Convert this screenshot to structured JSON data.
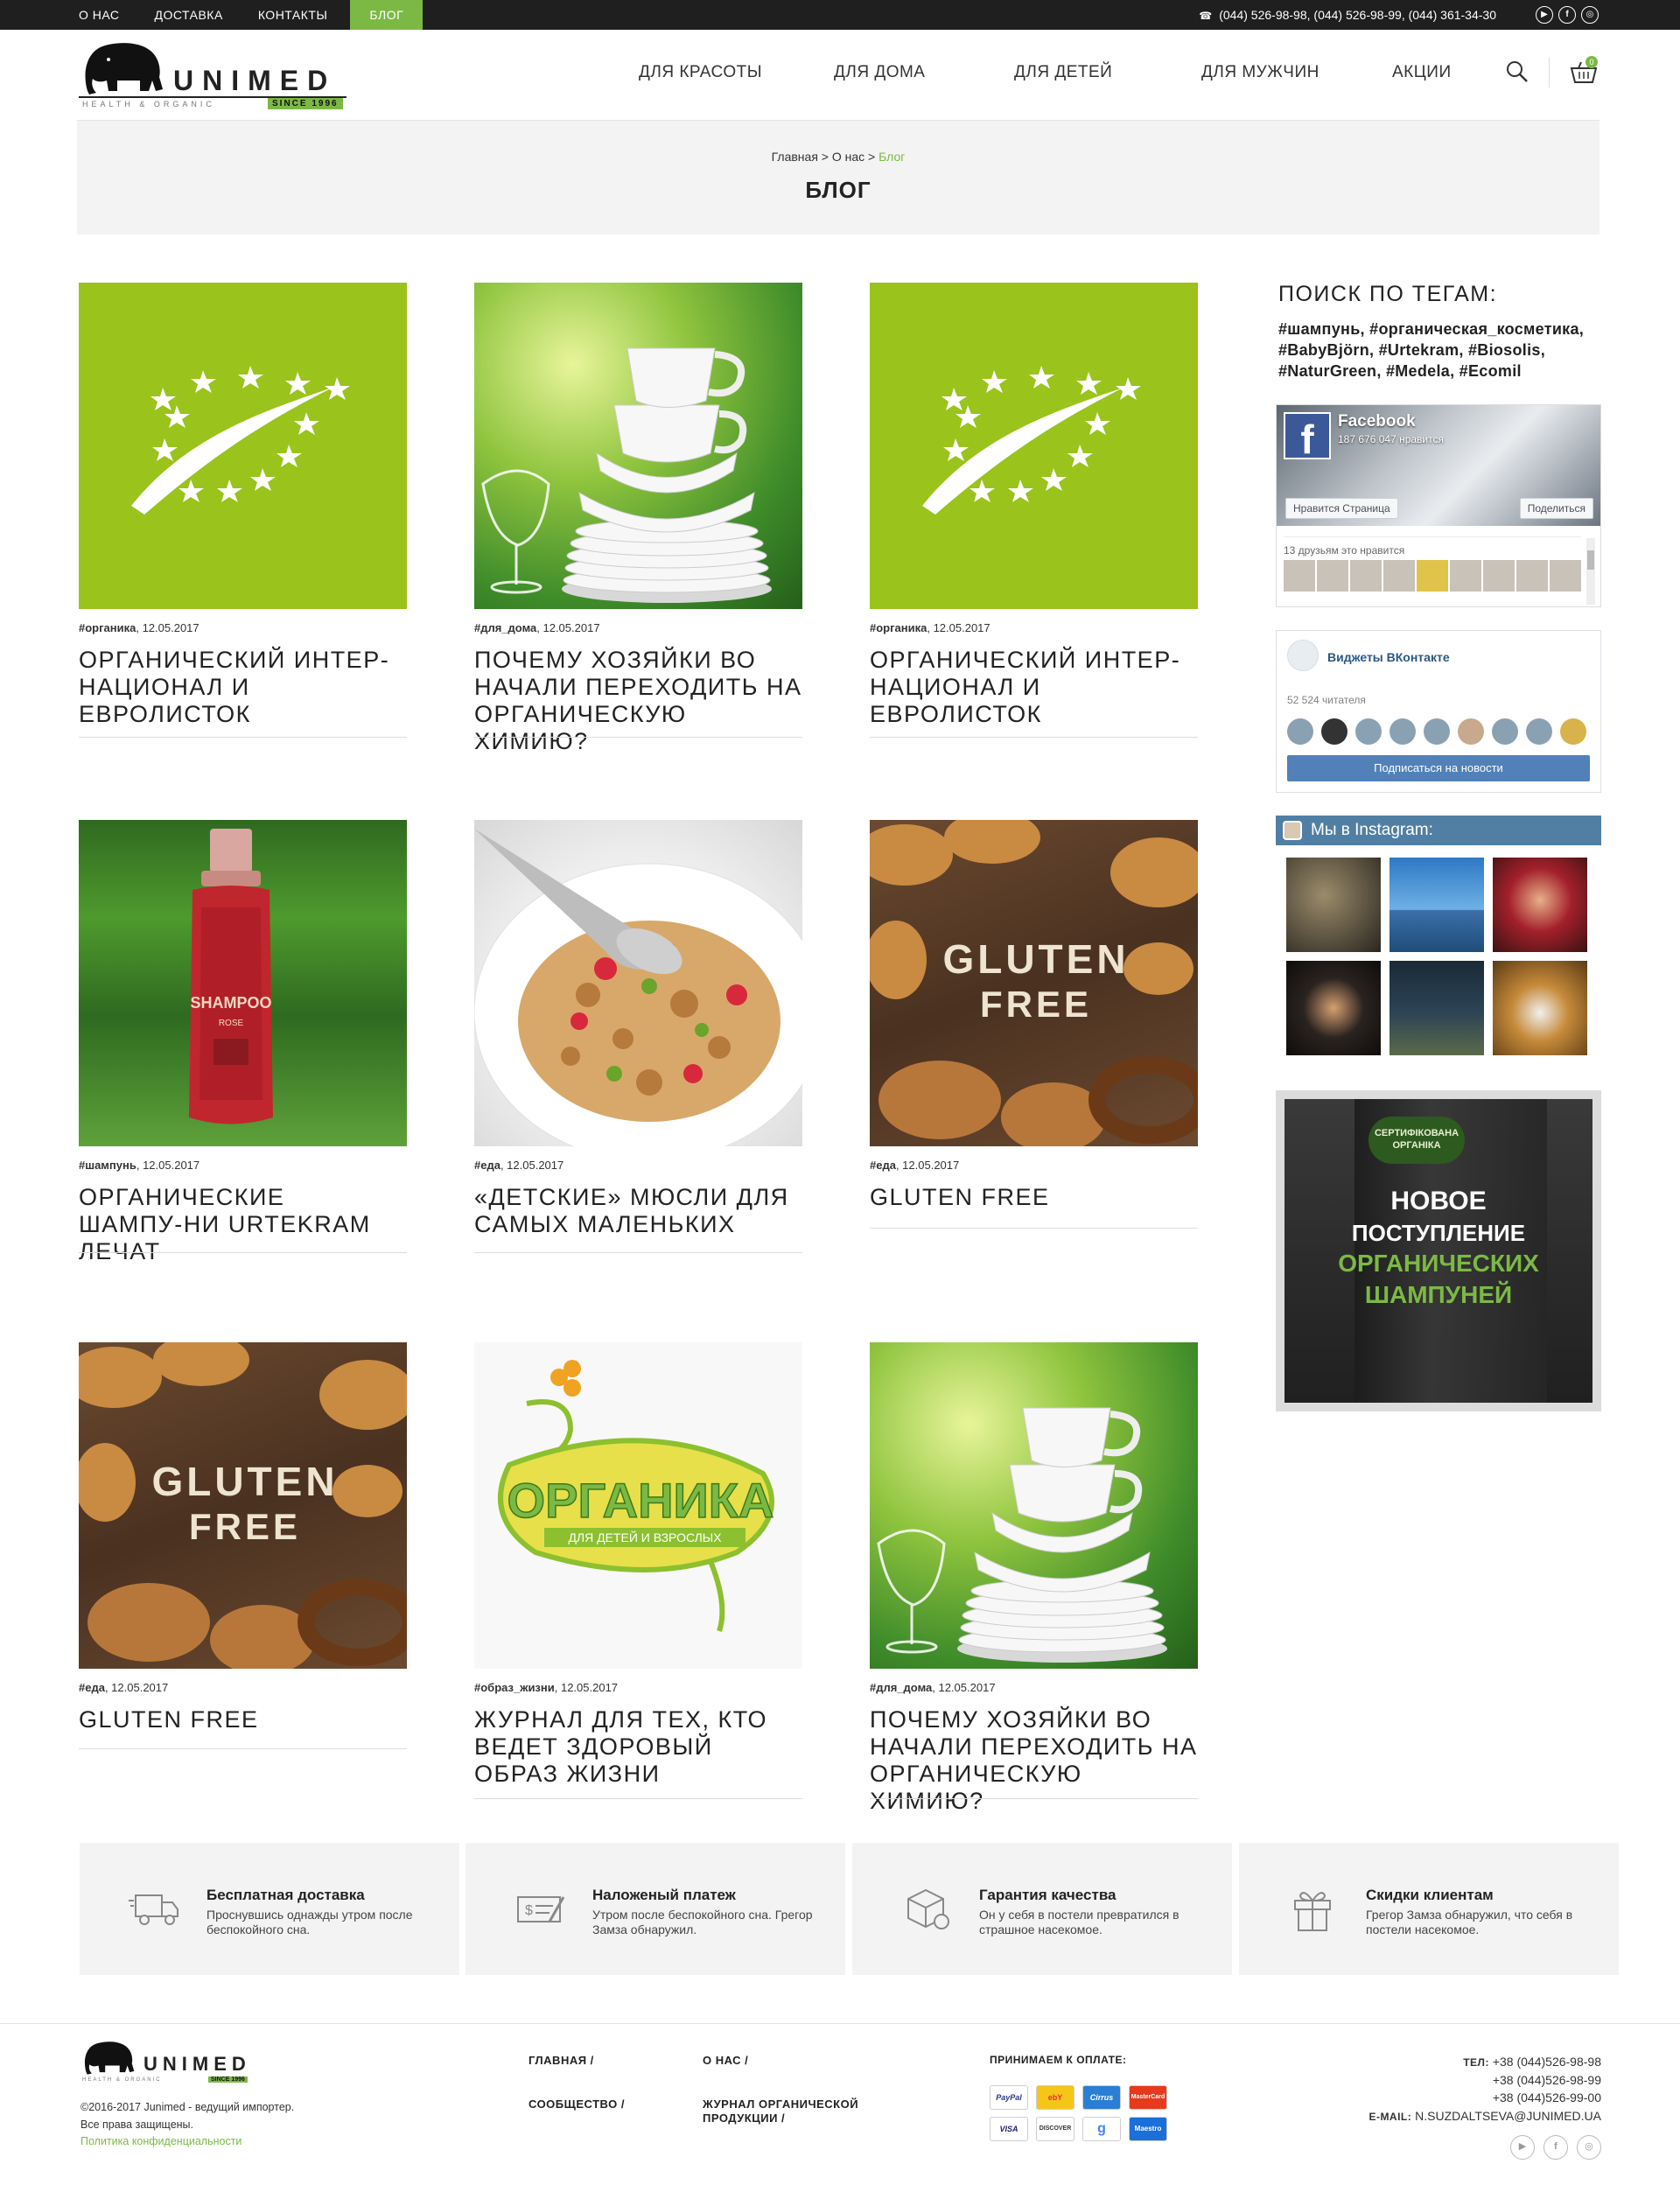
{
  "topbar": {
    "nav": [
      {
        "label": "О НАС"
      },
      {
        "label": "ДОСТАВКА"
      },
      {
        "label": "КОНТАКТЫ"
      },
      {
        "label": "БЛОГ"
      }
    ],
    "phones": "(044) 526-98-98, (044) 526-98-99, (044) 361-34-30",
    "social_icons": [
      "youtube-icon",
      "facebook-icon",
      "instagram-icon"
    ]
  },
  "logo": {
    "name": "UNIMED",
    "tagline": "HEALTH & ORGANIC",
    "since": "SINCE 1996"
  },
  "mainnav": {
    "items": [
      {
        "label": "ДЛЯ КРАСОТЫ"
      },
      {
        "label": "ДЛЯ ДОМА"
      },
      {
        "label": "ДЛЯ ДЕТЕЙ"
      },
      {
        "label": "ДЛЯ МУЖЧИН"
      },
      {
        "label": "АКЦИИ"
      }
    ],
    "cart_count": "0"
  },
  "breadcrumb": {
    "home": "Главная",
    "sep1": " > ",
    "about": "О нас",
    "sep2": " > ",
    "current": "Блог"
  },
  "page_title": "БЛОГ",
  "posts": [
    {
      "tag": "#органика",
      "date": ", 12.05.2017",
      "title": "ОРГАНИЧЕСКИЙ ИНТЕР-НАЦИОНАЛ И ЕВРОЛИСТОК",
      "art": "eu-leaf-image"
    },
    {
      "tag": "#для_дома",
      "date": ", 12.05.2017",
      "title": "ПОЧЕМУ ХОЗЯЙКИ ВО НАЧАЛИ ПЕРЕХОДИТЬ НА ОРГАНИЧЕСКУЮ ХИМИЮ?",
      "art": "dishes-image"
    },
    {
      "tag": "#органика",
      "date": ", 12.05.2017",
      "title": "ОРГАНИЧЕСКИЙ ИНТЕР-НАЦИОНАЛ И ЕВРОЛИСТОК",
      "art": "eu-leaf-image"
    },
    {
      "tag": "#шампунь",
      "date": ", 12.05.2017",
      "title": "ОРГАНИЧЕСКИЕ ШАМПУ-НИ URTEKRAM ЛЕЧАТ",
      "art": "shampoo-image",
      "bottle_text": "SHAMPOO",
      "bottle_sub": "ROSE"
    },
    {
      "tag": "#еда",
      "date": ", 12.05.2017",
      "title": "«ДЕТСКИЕ» МЮСЛИ ДЛЯ САМЫХ МАЛЕНЬКИХ",
      "art": "muesli-image"
    },
    {
      "tag": "#еда",
      "date": ", 12.05.2017",
      "title": "GLUTEN FREE",
      "art": "gluten-image",
      "art_text1": "GLUTEN",
      "art_text2": "FREE"
    },
    {
      "tag": "#еда",
      "date": ", 12.05.2017",
      "title": "GLUTEN FREE",
      "art": "gluten-image",
      "art_text1": "GLUTEN",
      "art_text2": "FREE"
    },
    {
      "tag": "#образ_жизни",
      "date": ", 12.05.2017",
      "title": "ЖУРНАЛ ДЛЯ ТЕХ, КТО ВЕДЕТ ЗДОРОВЫЙ ОБРАЗ ЖИЗНИ",
      "art": "organika-logo-image",
      "art_text1": "ОРГАНИКА",
      "art_text2": "ДЛЯ ДЕТЕЙ И ВЗРОСЛЫХ"
    },
    {
      "tag": "#для_дома",
      "date": ", 12.05.2017",
      "title": "ПОЧЕМУ ХОЗЯЙКИ ВО НАЧАЛИ ПЕРЕХОДИТЬ НА ОРГАНИЧЕСКУЮ ХИМИЮ?",
      "art": "dishes-image"
    }
  ],
  "sidebar": {
    "tags_title": "ПОИСК ПО ТЕГАМ:",
    "tags": "#шампунь, #органическая_косметика, #BabyBjörn, #Urtekram, #Biosolis, #NaturGreen, #Medela, #Ecomil",
    "facebook": {
      "name": "Facebook",
      "likes": "187 676 047 нравится",
      "like_btn": "Нравится Страница",
      "share_btn": "Поделиться",
      "friends": "13 друзьям это нравится"
    },
    "vk": {
      "title": "Виджеты ВКонтакте",
      "count": "52 524 читателя",
      "button": "Подписаться на новости"
    },
    "instagram": {
      "title": "Мы в Instagram:"
    },
    "promo": {
      "badge": "СЕРТИФІКОВАНА ОРГАНІКА",
      "line1": "НОВОЕ",
      "line2": "ПОСТУПЛЕНИЕ",
      "line3": "ОРГАНИЧЕСКИХ",
      "line4": "ШАМПУНЕЙ"
    }
  },
  "features": [
    {
      "title": "Бесплатная доставка",
      "desc": "Проснувшись однажды утром после беспокойного сна.",
      "icon": "truck-icon"
    },
    {
      "title": "Наложеный платеж",
      "desc": "Утром после беспокойного сна. Грегор Замза обнаружил.",
      "icon": "payment-check-icon"
    },
    {
      "title": "Гарантия качества",
      "desc": "Он у себя в постели превратился в страшное насекомое.",
      "icon": "quality-box-icon"
    },
    {
      "title": "Скидки клиентам",
      "desc": "Грегор Замза обнаружил, что себя в постели насекомое.",
      "icon": "gift-icon"
    }
  ],
  "footer": {
    "copyright_line1": "©2016-2017 Junimed - ведущий импортер.",
    "copyright_line2": "Все права защищены.",
    "policy": "Политика конфиденциальности",
    "links": [
      {
        "label": "ГЛАВНАЯ /"
      },
      {
        "label": "О НАС /"
      },
      {
        "label": "СООБЩЕСТВО /"
      },
      {
        "label": "ЖУРНАЛ ОРГАНИЧЕСКОЙ ПРОДУКЦИИ /"
      }
    ],
    "payment_title": "ПРИНИМАЕМ К ОПЛАТЕ:",
    "payments": [
      "PayPal",
      "ebY",
      "Cirrus",
      "MasterCard",
      "VISA",
      "DISCOVER",
      "g",
      "Maestro"
    ],
    "phone_label": "ТЕЛ:",
    "phone1": "+38 (044)526-98-98",
    "phone2": "+38 (044)526-98-99",
    "phone3": "+38 (044)526-99-00",
    "email_label": "E-MAIL:",
    "email": "N.SUZDALTSEVA@JUNIMED.UA"
  },
  "colors": {
    "accent": "#7cb944",
    "topbar": "#1f1f1f",
    "banner": "#f3f3f3"
  }
}
